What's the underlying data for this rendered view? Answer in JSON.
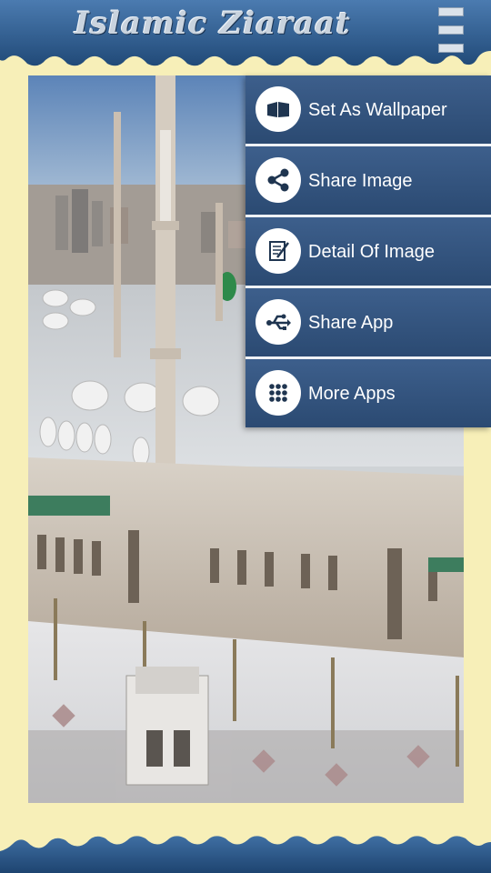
{
  "header": {
    "title": "Islamic Ziaraat",
    "menu_icon": "hamburger-menu-icon"
  },
  "image": {
    "description_icon": "mosque-photo"
  },
  "popup_menu": {
    "items": [
      {
        "label": "Set As Wallpaper",
        "icon": "wallpaper-icon"
      },
      {
        "label": "Share Image",
        "icon": "share-icon"
      },
      {
        "label": "Detail Of Image",
        "icon": "notes-icon"
      },
      {
        "label": "Share App",
        "icon": "usb-share-icon"
      },
      {
        "label": "More Apps",
        "icon": "grid-dots-icon"
      }
    ]
  },
  "colors": {
    "background": "#f7efb8",
    "header_blue": "#2f5f92",
    "menu_item": "#34557f",
    "menu_text": "#ffffff"
  }
}
